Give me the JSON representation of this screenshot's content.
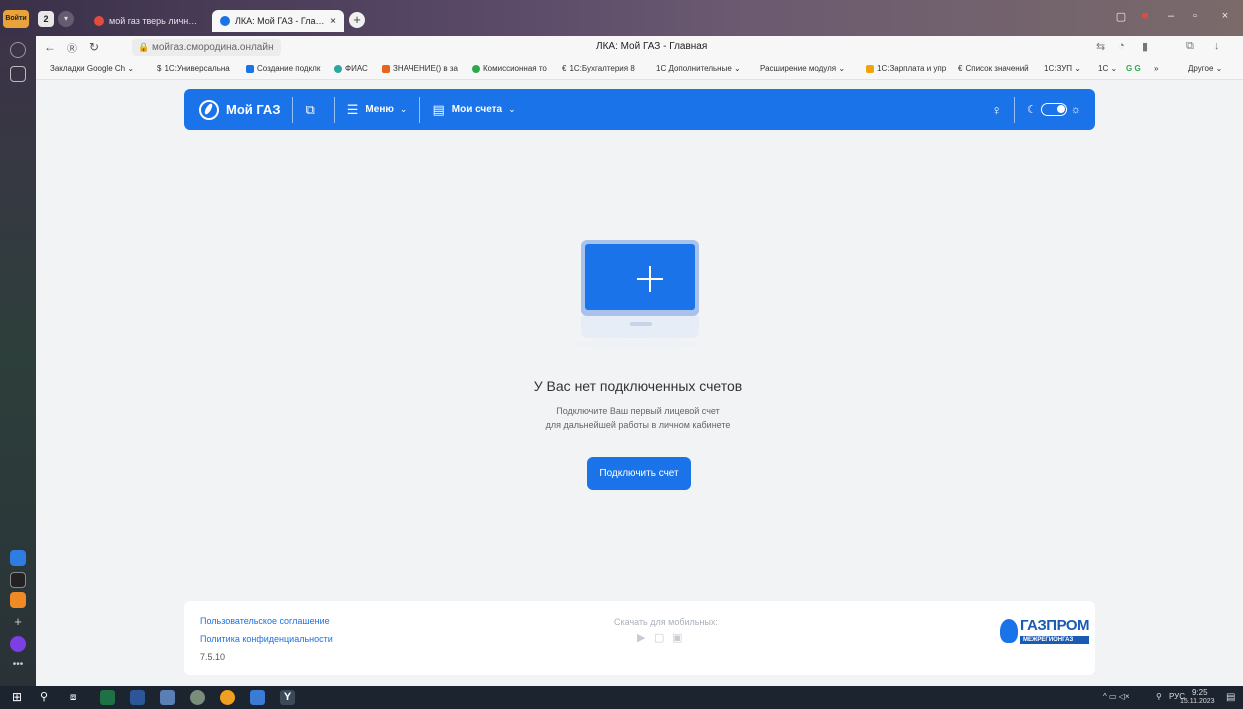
{
  "browser": {
    "yandex_button": "Войти",
    "tab_count": "2",
    "tabs": [
      {
        "title": "мой газ тверь личный каб"
      },
      {
        "title": "ЛКА: Мой ГАЗ - Главная"
      }
    ],
    "url": "мойгаз.смородина.онлайн",
    "page_title": "ЛКА: Мой ГАЗ - Главная",
    "bookmarks": [
      "Закладки Google Ch",
      "1С:Универсальна",
      "Создание подклк",
      "ФИАС",
      "ЗНАЧЕНИЕ() в за",
      "Комиссионная то",
      "1С:Бухгалтерия 8",
      "1С Дополнительные",
      "Расширение модуля",
      "1С:Зарплата и упр",
      "Список значений",
      "1С:ЗУП",
      "1С",
      "G G",
      "»",
      "Другое"
    ]
  },
  "app": {
    "brand": "Мой ГАЗ",
    "menu_label": "Меню",
    "accounts_label": "Мои счета",
    "empty_title": "У Вас нет подключенных счетов",
    "empty_desc_line1": "Подключите Ваш первый лицевой счет",
    "empty_desc_line2": "для дальнейшей работы в личном кабинете",
    "connect_button": "Подключить счет"
  },
  "footer": {
    "user_agreement": "Пользовательское соглашение",
    "privacy_policy": "Политика конфиденциальности",
    "version": "7.5.10",
    "mobile_label": "Скачать для мобильных:",
    "brand_name": "ГАЗПРОМ",
    "brand_sub": "МЕЖРЕГИОНГАЗ"
  },
  "taskbar": {
    "lang": "РУС",
    "time": "9:25",
    "date": "15.11.2023"
  },
  "colors": {
    "accent": "#1a73e8",
    "page_bg": "#f2f3f5"
  }
}
